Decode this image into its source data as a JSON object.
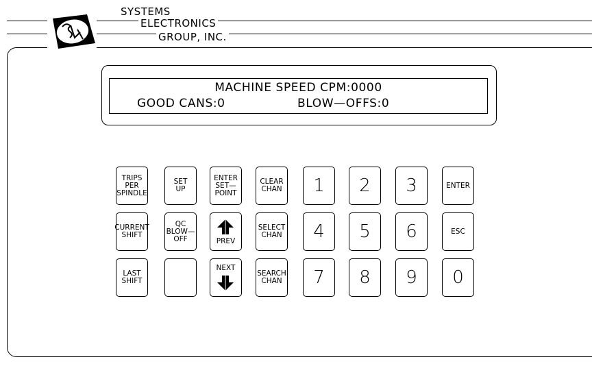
{
  "header": {
    "company_line1": "SYSTEMS",
    "company_line2": "ELECTRONICS",
    "company_line3": "GROUP,  INC.",
    "logo_icon": "sea-logo-icon"
  },
  "display": {
    "line1": "MACHINE  SPEED  CPM:0000",
    "good_cans": "GOOD  CANS:0",
    "blow_offs": "BLOW—OFFS:0"
  },
  "keypad": {
    "trips_per_spindle": [
      "TRIPS",
      "PER",
      "SPINDLE"
    ],
    "set_up": [
      "SET",
      "UP"
    ],
    "enter_set_point": [
      "ENTER",
      "SET—",
      "POINT"
    ],
    "clear_chan": [
      "CLEAR",
      "CHAN"
    ],
    "current_shift": [
      "CURRENT",
      "SHIFT"
    ],
    "qc_blow_off": [
      "QC",
      "BLOW—",
      "OFF"
    ],
    "prev": "PREV",
    "select_chan": [
      "SELECT",
      "CHAN"
    ],
    "last_shift": [
      "LAST",
      "SHIFT"
    ],
    "next": "NEXT",
    "search_chan": [
      "SEARCH",
      "CHAN"
    ],
    "digits": [
      "1",
      "2",
      "3",
      "4",
      "5",
      "6",
      "7",
      "8",
      "9",
      "0"
    ],
    "enter": "ENTER",
    "esc": "ESC"
  }
}
